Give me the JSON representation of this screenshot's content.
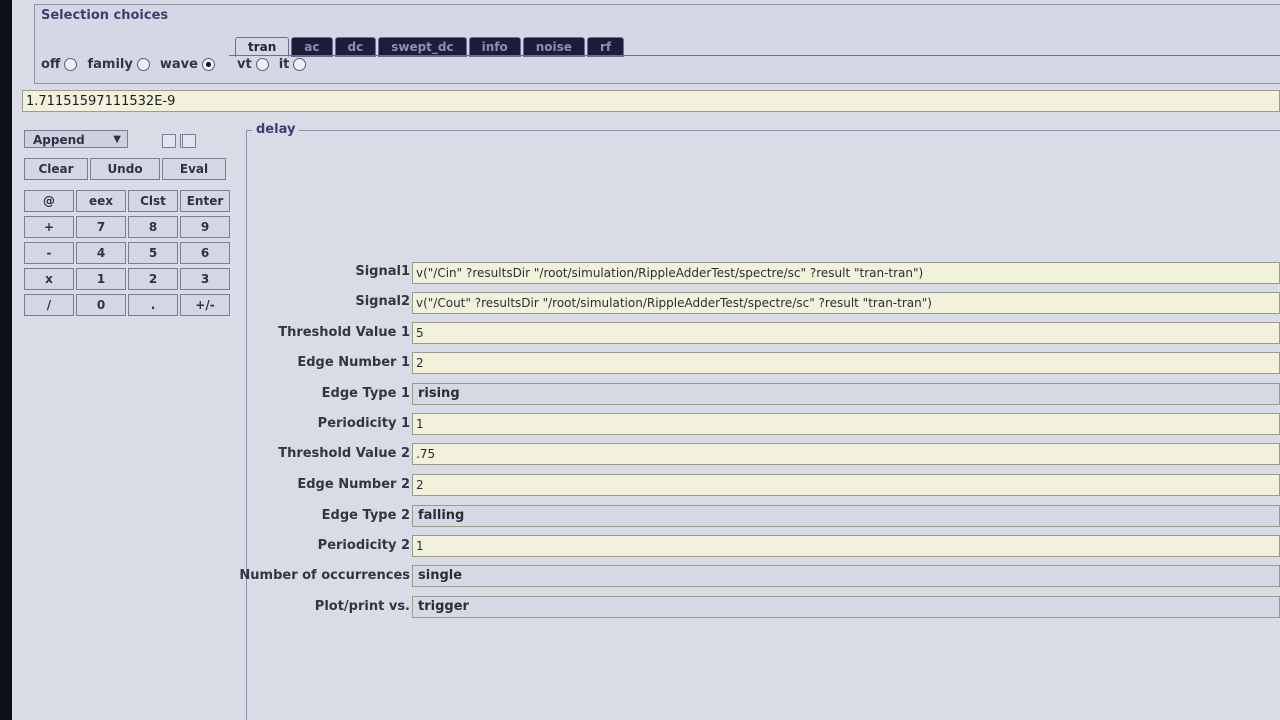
{
  "selection": {
    "title": "Selection choices",
    "radios": [
      {
        "label": "off",
        "selected": false
      },
      {
        "label": "family",
        "selected": false
      },
      {
        "label": "wave",
        "selected": true
      }
    ],
    "tabs": [
      "tran",
      "ac",
      "dc",
      "swept_dc",
      "info",
      "noise",
      "rf"
    ],
    "active_tab": "tran",
    "sub_radios": [
      {
        "label": "vt",
        "selected": false
      },
      {
        "label": "it",
        "selected": false
      }
    ]
  },
  "expression": "1.71151597111532E-9",
  "calculator": {
    "mode": "Append",
    "actions": [
      "Clear",
      "Undo",
      "Eval"
    ],
    "keys": [
      "@",
      "eex",
      "Clst",
      "Enter",
      "+",
      "7",
      "8",
      "9",
      "-",
      "4",
      "5",
      "6",
      "x",
      "1",
      "2",
      "3",
      "/",
      "0",
      ".",
      "+/-"
    ]
  },
  "delay": {
    "title": "delay",
    "fields": [
      {
        "label": "Signal1",
        "value": "v(\"/Cin\" ?resultsDir \"/root/simulation/RippleAdderTest/spectre/sc\" ?result \"tran-tran\")",
        "kind": "text"
      },
      {
        "label": "Signal2",
        "value": "v(\"/Cout\" ?resultsDir \"/root/simulation/RippleAdderTest/spectre/sc\" ?result \"tran-tran\")",
        "kind": "text"
      },
      {
        "label": "Threshold Value 1",
        "value": "5",
        "kind": "text"
      },
      {
        "label": "Edge Number 1",
        "value": "2",
        "kind": "text"
      },
      {
        "label": "Edge Type 1",
        "value": "rising",
        "kind": "cycle"
      },
      {
        "label": "Periodicity 1",
        "value": "1",
        "kind": "text"
      },
      {
        "label": "Threshold Value 2",
        "value": ".75",
        "kind": "text"
      },
      {
        "label": "Edge Number 2",
        "value": "2",
        "kind": "text"
      },
      {
        "label": "Edge Type 2",
        "value": "falling",
        "kind": "cycle"
      },
      {
        "label": "Periodicity 2",
        "value": "1",
        "kind": "text"
      },
      {
        "label": "Number of occurrences",
        "value": "single",
        "kind": "cycle"
      },
      {
        "label": "Plot/print vs.",
        "value": "trigger",
        "kind": "cycle"
      }
    ]
  }
}
